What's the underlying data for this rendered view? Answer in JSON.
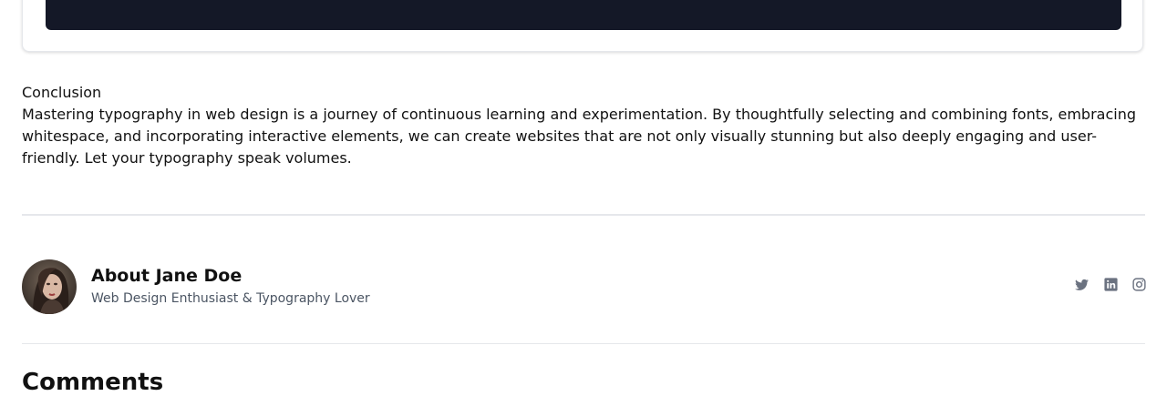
{
  "conclusion": {
    "heading": "Conclusion",
    "body": "Mastering typography in web design is a journey of continuous learning and experimentation. By thoughtfully selecting and combining fonts, embracing whitespace, and incorporating interactive elements, we can create websites that are not only visually stunning but also deeply engaging and user-friendly. Let your typography speak volumes."
  },
  "author": {
    "title": "About Jane Doe",
    "subtitle": "Web Design Enthusiast & Typography Lover",
    "social": [
      {
        "icon": "twitter-icon"
      },
      {
        "icon": "linkedin-icon"
      },
      {
        "icon": "instagram-icon"
      }
    ]
  },
  "comments": {
    "heading": "Comments"
  },
  "colors": {
    "dark_block": "#141827",
    "divider": "#e5e7eb",
    "muted_text": "#4b5563",
    "icon": "#6b7280"
  }
}
